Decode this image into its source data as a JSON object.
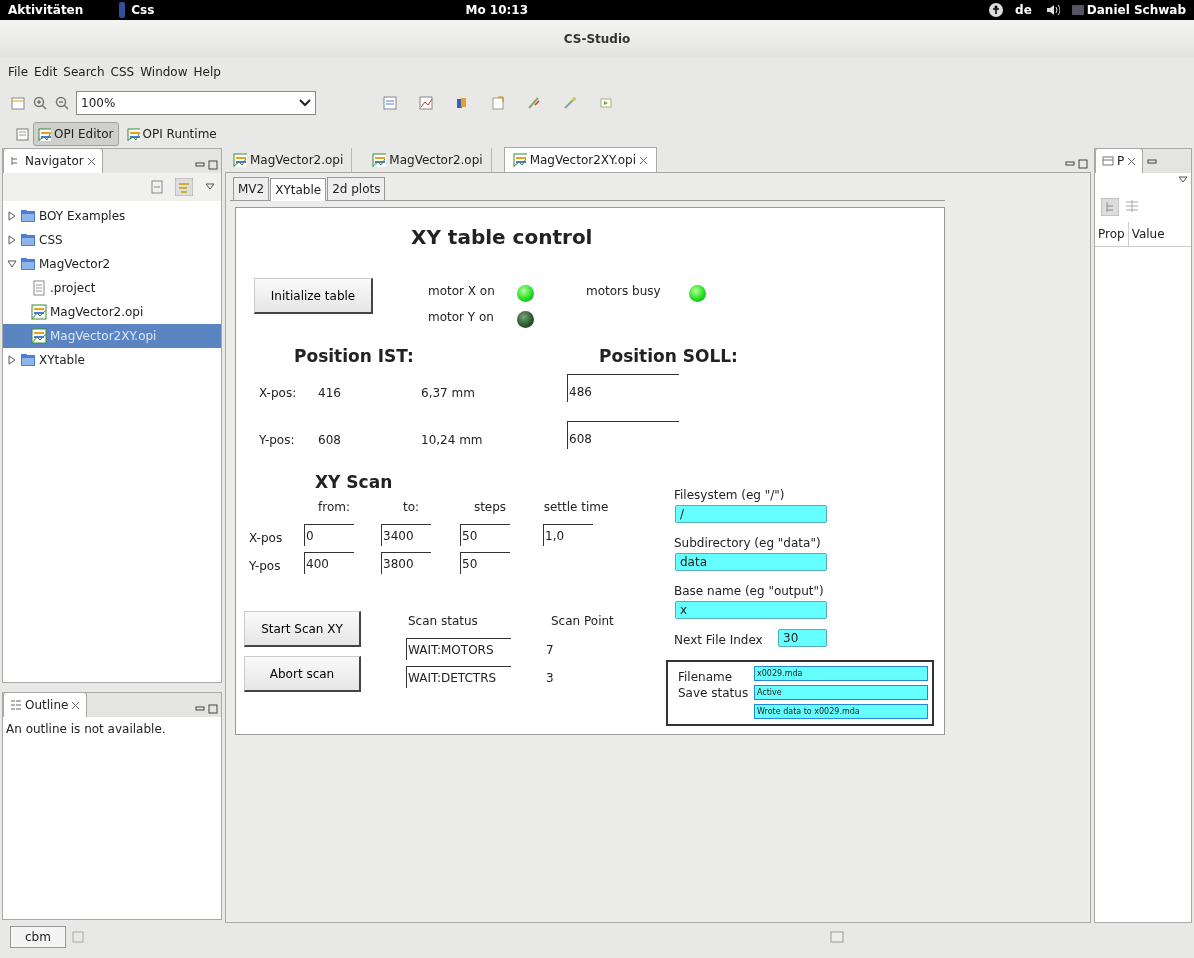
{
  "top_bar": {
    "activities": "Aktivitäten",
    "app": "Css",
    "clock": "Mo 10:13",
    "language": "de",
    "user": "Daniel Schwab"
  },
  "window": {
    "title": "CS-Studio"
  },
  "menu": [
    "File",
    "Edit",
    "Search",
    "CSS",
    "Window",
    "Help"
  ],
  "toolbar": {
    "zoom": "100%"
  },
  "perspectives": [
    {
      "label": "OPI Editor",
      "selected": true
    },
    {
      "label": "OPI Runtime",
      "selected": false
    }
  ],
  "navigator": {
    "title": "Navigator",
    "tree": [
      {
        "label": "BOY Examples",
        "kind": "folder",
        "expanded": false,
        "selected": false
      },
      {
        "label": "CSS",
        "kind": "folder",
        "expanded": false,
        "selected": false
      },
      {
        "label": "MagVector2",
        "kind": "folder",
        "expanded": true,
        "selected": false,
        "children": [
          {
            "label": ".project",
            "kind": "file",
            "selected": false
          },
          {
            "label": "MagVector2.opi",
            "kind": "opi",
            "selected": false
          },
          {
            "label": "MagVector2XY.opi",
            "kind": "opi",
            "selected": true
          }
        ]
      },
      {
        "label": "XYtable",
        "kind": "folder",
        "expanded": false,
        "selected": false
      }
    ]
  },
  "outline": {
    "title": "Outline",
    "message": "An outline is not available."
  },
  "editor_tabs": [
    {
      "label": "MagVector2.opi",
      "selected": false
    },
    {
      "label": "MagVector2.opi",
      "selected": false
    },
    {
      "label": "MagVector2XY.opi",
      "selected": true
    }
  ],
  "display_tabs": [
    {
      "label": "MV2",
      "selected": false
    },
    {
      "label": "XYtable",
      "selected": true
    },
    {
      "label": "2d plots",
      "selected": false
    }
  ],
  "display": {
    "title": "XY table control",
    "init_button": "Initialize table",
    "leds": [
      {
        "label": "motor X on",
        "on": true
      },
      {
        "label": "motor Y on",
        "on": false
      },
      {
        "label": "motors busy",
        "on": true
      }
    ],
    "ist": {
      "heading": "Position IST:",
      "rows": [
        {
          "label": "X-pos:",
          "raw": "416",
          "mm": "6,37 mm"
        },
        {
          "label": "Y-pos:",
          "raw": "608",
          "mm": "10,24 mm"
        }
      ]
    },
    "soll": {
      "heading": "Position SOLL:",
      "values": [
        "486",
        "608"
      ]
    },
    "scan": {
      "heading": "XY Scan",
      "columns": [
        "from:",
        "to:",
        "steps",
        "settle time"
      ],
      "rows": [
        {
          "label": "X-pos",
          "values": [
            "0",
            "3400",
            "50",
            "1,0"
          ]
        },
        {
          "label": "Y-pos",
          "values": [
            "400",
            "3800",
            "50"
          ]
        }
      ]
    },
    "buttons": [
      "Start Scan XY",
      "Abort scan"
    ],
    "status": {
      "headings": [
        "Scan status",
        "Scan Point"
      ],
      "rows": [
        {
          "status": "WAIT:MOTORS",
          "point": "7"
        },
        {
          "status": "WAIT:DETCTRS",
          "point": "3"
        }
      ]
    },
    "files": [
      {
        "label": "Filesystem (eg \"/\")",
        "value": "/"
      },
      {
        "label": "Subdirectory (eg \"data\")",
        "value": "data"
      },
      {
        "label": "Base name (eg \"output\")",
        "value": "x"
      }
    ],
    "next_index": {
      "label": "Next File Index",
      "value": "30"
    },
    "save_box": {
      "labels": [
        "Filename",
        "Save status"
      ],
      "values": [
        "x0029.mda",
        "Active",
        "Wrote data to x0029.mda"
      ]
    }
  },
  "properties": {
    "title": "P",
    "columns": [
      "Prop",
      "Value"
    ]
  },
  "status_bar": {
    "field": "cbm"
  }
}
